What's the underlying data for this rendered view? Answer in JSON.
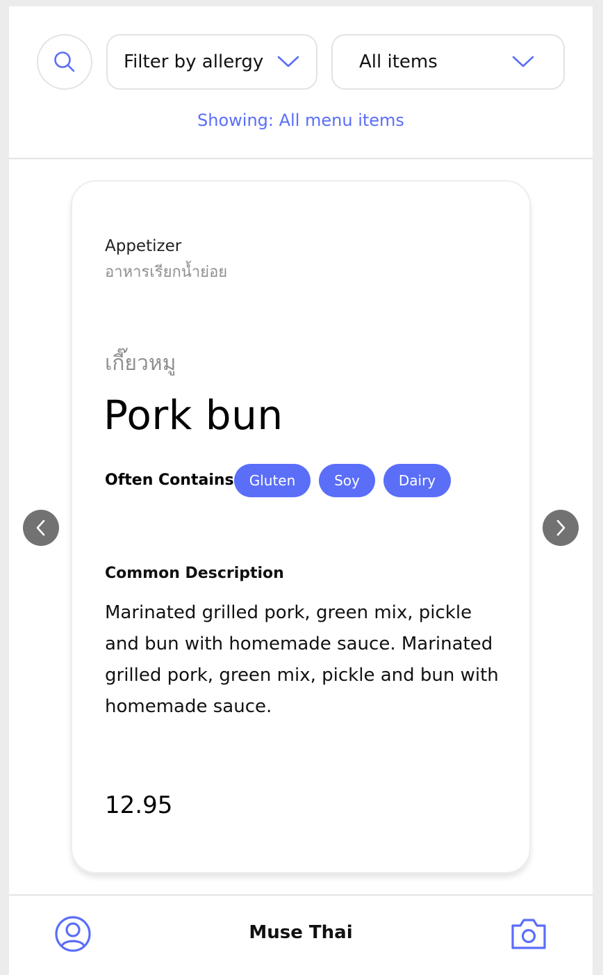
{
  "header": {
    "search_icon": "search-icon",
    "allergy_filter": {
      "label": "Filter by allergy",
      "icon": "chevron-down-icon"
    },
    "items_filter": {
      "label": "All items",
      "icon": "chevron-down-icon"
    },
    "showing_text": "Showing: All menu items"
  },
  "card": {
    "category_en": "Appetizer",
    "category_th": "อาหารเรียกน้ำย่อย",
    "name_th": "เกี๊ยวหมู",
    "name_en": "Pork bun",
    "contains_label": "Often Contains",
    "allergens": [
      "Gluten",
      "Soy",
      "Dairy"
    ],
    "description_title": "Common Description",
    "description": "Marinated grilled pork, green mix, pickle and bun with homemade sauce. Marinated grilled pork, green mix, pickle and bun with homemade sauce.",
    "price": "12.95"
  },
  "nav": {
    "prev_icon": "chevron-left-icon",
    "next_icon": "chevron-right-icon"
  },
  "footer": {
    "title": "Muse Thai",
    "profile_icon": "user-circle-icon",
    "camera_icon": "camera-icon"
  },
  "colors": {
    "accent": "#5a6ef8",
    "arrow_bg": "#727272",
    "muted_text": "#8f8f8f"
  }
}
